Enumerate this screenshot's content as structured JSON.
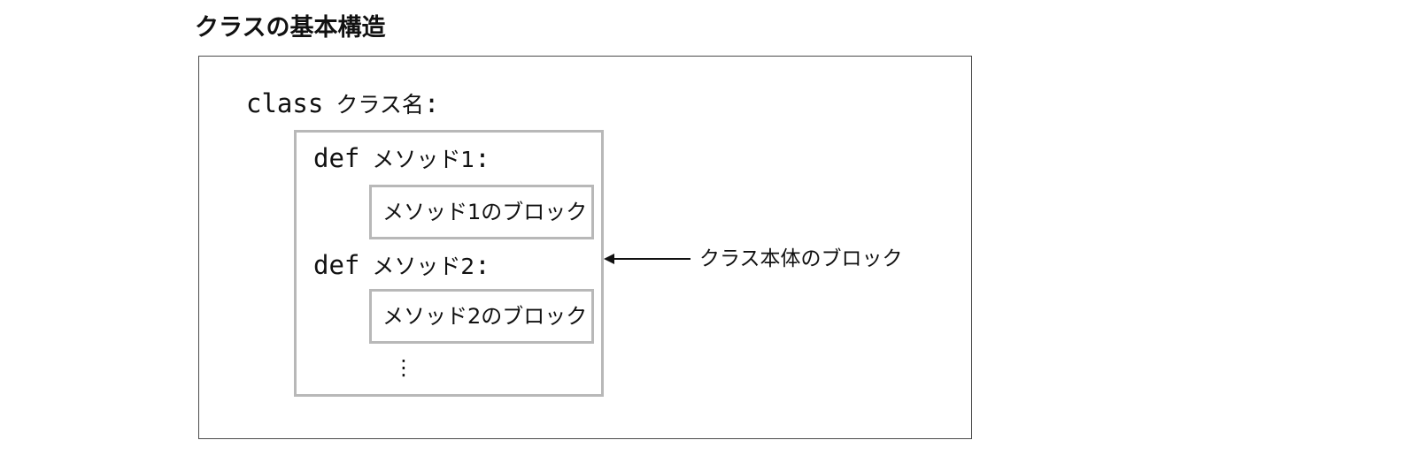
{
  "title": "クラスの基本構造",
  "code": {
    "class_keyword": "class",
    "class_name": "クラス名",
    "colon": ":",
    "methods": [
      {
        "def_keyword": "def",
        "name": "メソッド1",
        "block_label": "メソッド1のブロック"
      },
      {
        "def_keyword": "def",
        "name": "メソッド2",
        "block_label": "メソッド2のブロック"
      }
    ],
    "ellipsis": "⋮"
  },
  "callout": {
    "label": "クラス本体のブロック"
  }
}
